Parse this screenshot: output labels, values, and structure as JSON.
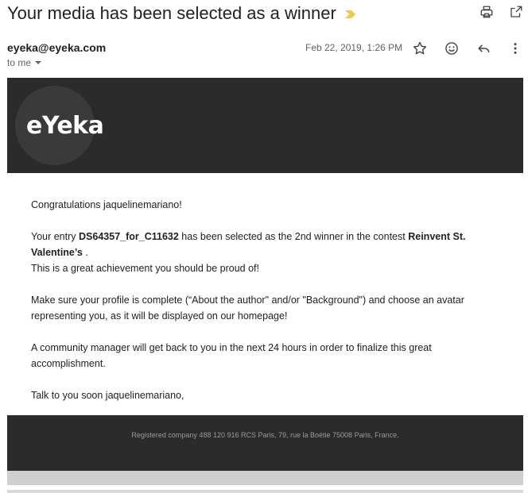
{
  "email": {
    "subject": "Your media has been selected as a winner",
    "sender": "eyeka@eyeka.com",
    "recipient_label": "to me",
    "date": "Feb 22, 2019, 1:26 PM"
  },
  "icons": {
    "importance": "importance-marker-icon",
    "print": "print-icon",
    "open_new_window": "open-in-new-window-icon",
    "star": "star-icon",
    "emoji": "emoji-icon",
    "reply": "reply-icon",
    "more": "more-vert-icon",
    "dropdown": "caret-down-icon"
  },
  "banner": {
    "logo_text": "eYeka"
  },
  "body": {
    "greeting": "Congratulations jaquelinemariano!",
    "entry_prefix": "Your entry",
    "entry_id": "DS64357_for_C11632",
    "entry_middle": "has been selected as the 2nd winner in the contest",
    "contest_name": "Reinvent St. Valentine’s",
    "entry_suffix": ".",
    "achievement": "This is a great achievement you should be proud of!",
    "profile_note": "Make sure your profile is complete (“About the author\" and/or \"Background\") and choose an avatar representing you, as it will be displayed on our homepage!",
    "manager_note": "A community manager will get back to you in the next 24 hours in order to finalize this great accomplishment.",
    "signoff": "Talk to you soon jaquelinemariano,"
  },
  "footer": {
    "registration": "Registered company 488 120 916 RCS Paris, 79, rue la Boétie 75008 Paris, France."
  },
  "colors": {
    "banner_bg": "#2b2b2b",
    "importance": "#f2c94c",
    "text": "#202124",
    "muted": "#5f6368"
  }
}
